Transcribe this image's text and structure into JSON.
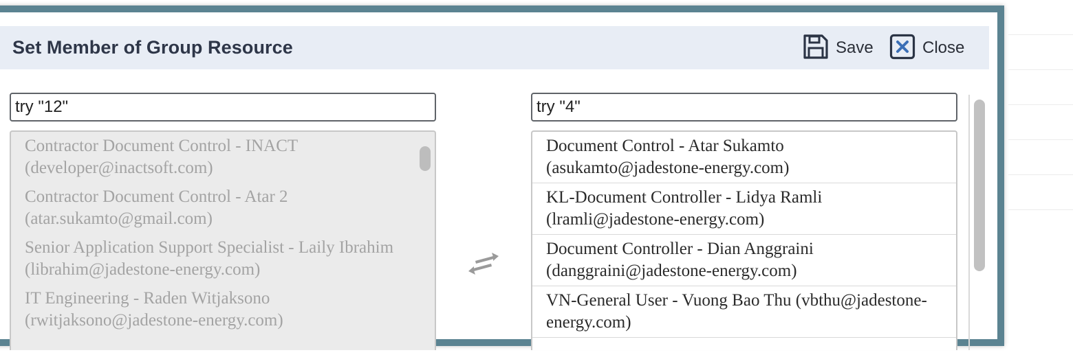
{
  "dialog": {
    "title": "Set Member of Group Resource",
    "save_label": "Save",
    "close_label": "Close"
  },
  "available": {
    "search_value": "try \"12\"",
    "items": [
      {
        "label": "Contractor Document Control - INACT (developer@inactsoft.com)"
      },
      {
        "label": "Contractor Document Control - Atar 2 (atar.sukamto@gmail.com)"
      },
      {
        "label": "Senior Application Support Specialist - Laily Ibrahim (librahim@jadestone-energy.com)"
      },
      {
        "label": "IT Engineering - Raden Witjaksono (rwitjaksono@jadestone-energy.com)"
      }
    ]
  },
  "selected": {
    "search_value": "try \"4\"",
    "items": [
      {
        "label": "Document Control - Atar Sukamto (asukamto@jadestone-energy.com)"
      },
      {
        "label": "KL-Document Controller - Lidya Ramli (lramli@jadestone-energy.com)"
      },
      {
        "label": "Document Controller - Dian Anggraini (danggraini@jadestone-energy.com)"
      },
      {
        "label": "VN-General User - Vuong Bao Thu (vbthu@jadestone-energy.com)"
      }
    ]
  },
  "icons": {
    "save": "save-icon",
    "close": "close-icon",
    "swap": "swap-arrows-icon"
  },
  "colors": {
    "dialog_border": "#5b8391",
    "header_bg": "#e8edf5",
    "title_text": "#2e3648",
    "close_icon_accent": "#3b6fb6",
    "disabled_list_bg": "#ebebeb"
  }
}
